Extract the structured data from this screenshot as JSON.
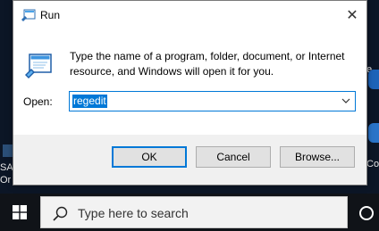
{
  "desktop": {
    "left_icon_lines": [
      "SA",
      "Or"
    ],
    "right_icon_lines": [
      "e",
      "Co"
    ]
  },
  "dialog": {
    "title": "Run",
    "icon": "run-icon",
    "close_glyph": "✕",
    "description": "Type the name of a program, folder, document, or Internet resource, and Windows will open it for you.",
    "open_label": "Open:",
    "open_value": "regedit",
    "buttons": {
      "ok": "OK",
      "cancel": "Cancel",
      "browse": "Browse..."
    }
  },
  "taskbar": {
    "start_icon": "windows-logo-icon",
    "search_placeholder": "Type here to search",
    "cortana_icon": "cortana-circle-icon"
  },
  "colors": {
    "accent": "#0078d7",
    "dialog_bg": "#f0f0f0",
    "taskbar_bg": "#101318"
  }
}
